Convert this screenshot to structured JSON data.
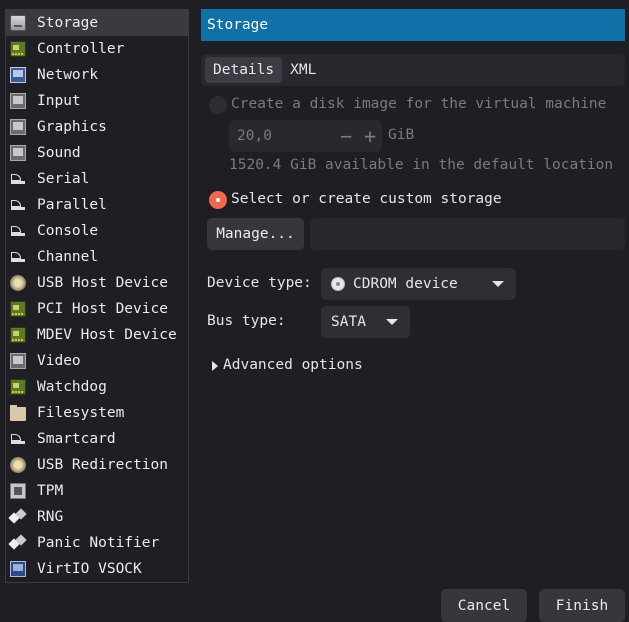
{
  "sidebar": {
    "items": [
      {
        "label": "Storage",
        "icon": "disk-icon"
      },
      {
        "label": "Controller",
        "icon": "controller-card-icon"
      },
      {
        "label": "Network",
        "icon": "network-icon"
      },
      {
        "label": "Input",
        "icon": "input-device-icon"
      },
      {
        "label": "Graphics",
        "icon": "graphics-icon"
      },
      {
        "label": "Sound",
        "icon": "sound-icon"
      },
      {
        "label": "Serial",
        "icon": "serial-port-icon"
      },
      {
        "label": "Parallel",
        "icon": "parallel-port-icon"
      },
      {
        "label": "Console",
        "icon": "console-icon"
      },
      {
        "label": "Channel",
        "icon": "channel-icon"
      },
      {
        "label": "USB Host Device",
        "icon": "usb-icon"
      },
      {
        "label": "PCI Host Device",
        "icon": "pci-card-icon"
      },
      {
        "label": "MDEV Host Device",
        "icon": "mdev-card-icon"
      },
      {
        "label": "Video",
        "icon": "video-icon"
      },
      {
        "label": "Watchdog",
        "icon": "watchdog-card-icon"
      },
      {
        "label": "Filesystem",
        "icon": "folder-icon"
      },
      {
        "label": "Smartcard",
        "icon": "smartcard-icon"
      },
      {
        "label": "USB Redirection",
        "icon": "usb-redirection-icon"
      },
      {
        "label": "TPM",
        "icon": "chip-icon"
      },
      {
        "label": "RNG",
        "icon": "rng-dice-icon"
      },
      {
        "label": "Panic Notifier",
        "icon": "panic-notifier-icon"
      },
      {
        "label": "VirtIO VSOCK",
        "icon": "vsock-icon"
      }
    ],
    "selected_index": 0
  },
  "header": {
    "title": "Storage"
  },
  "tabs": [
    {
      "label": "Details",
      "active": true
    },
    {
      "label": "XML",
      "active": false
    }
  ],
  "storage": {
    "create_disk_label": "Create a disk image for the virtual machine",
    "size_value": "20,0",
    "size_unit": "GiB",
    "available_text": "1520.4 GiB available in the default location",
    "custom_storage_label": "Select or create custom storage",
    "manage_button": "Manage...",
    "path_value": "",
    "device_type_label": "Device type:",
    "device_type_value": "CDROM device",
    "bus_type_label": "Bus type:",
    "bus_type_value": "SATA",
    "advanced_label": "Advanced options"
  },
  "footer": {
    "cancel_label": "Cancel",
    "finish_label": "Finish"
  },
  "colors": {
    "header_bg": "#1070a8",
    "radio_selected": "#ef6a4c",
    "background": "#1e1e24"
  }
}
